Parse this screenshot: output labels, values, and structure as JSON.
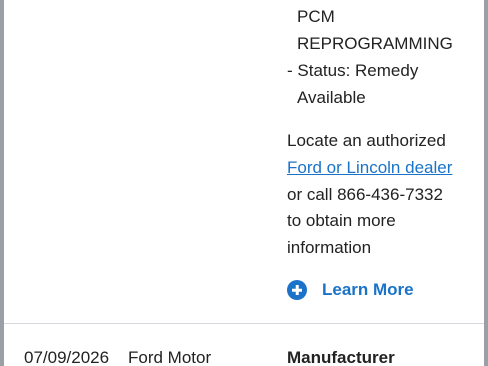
{
  "recall": {
    "component_line1": "PCM",
    "component_line2": "REPROGRAMMING",
    "status_line1": "- Status: Remedy",
    "status_line2": "Available"
  },
  "contact": {
    "line1": "Locate an authorized",
    "dealer_link": "Ford or Lincoln dealer",
    "line3": "or call 866-436-7332",
    "line4": "to obtain more",
    "line5": "information"
  },
  "learn_more": {
    "label": "Learn More",
    "icon": "plus-circle-icon"
  },
  "next_row": {
    "date": "07/09/2026",
    "source": "Ford Motor",
    "type": "Manufacturer"
  },
  "colors": {
    "link": "#1a73c8",
    "divider": "#d5d8dc",
    "frame": "#9aa0a6"
  }
}
